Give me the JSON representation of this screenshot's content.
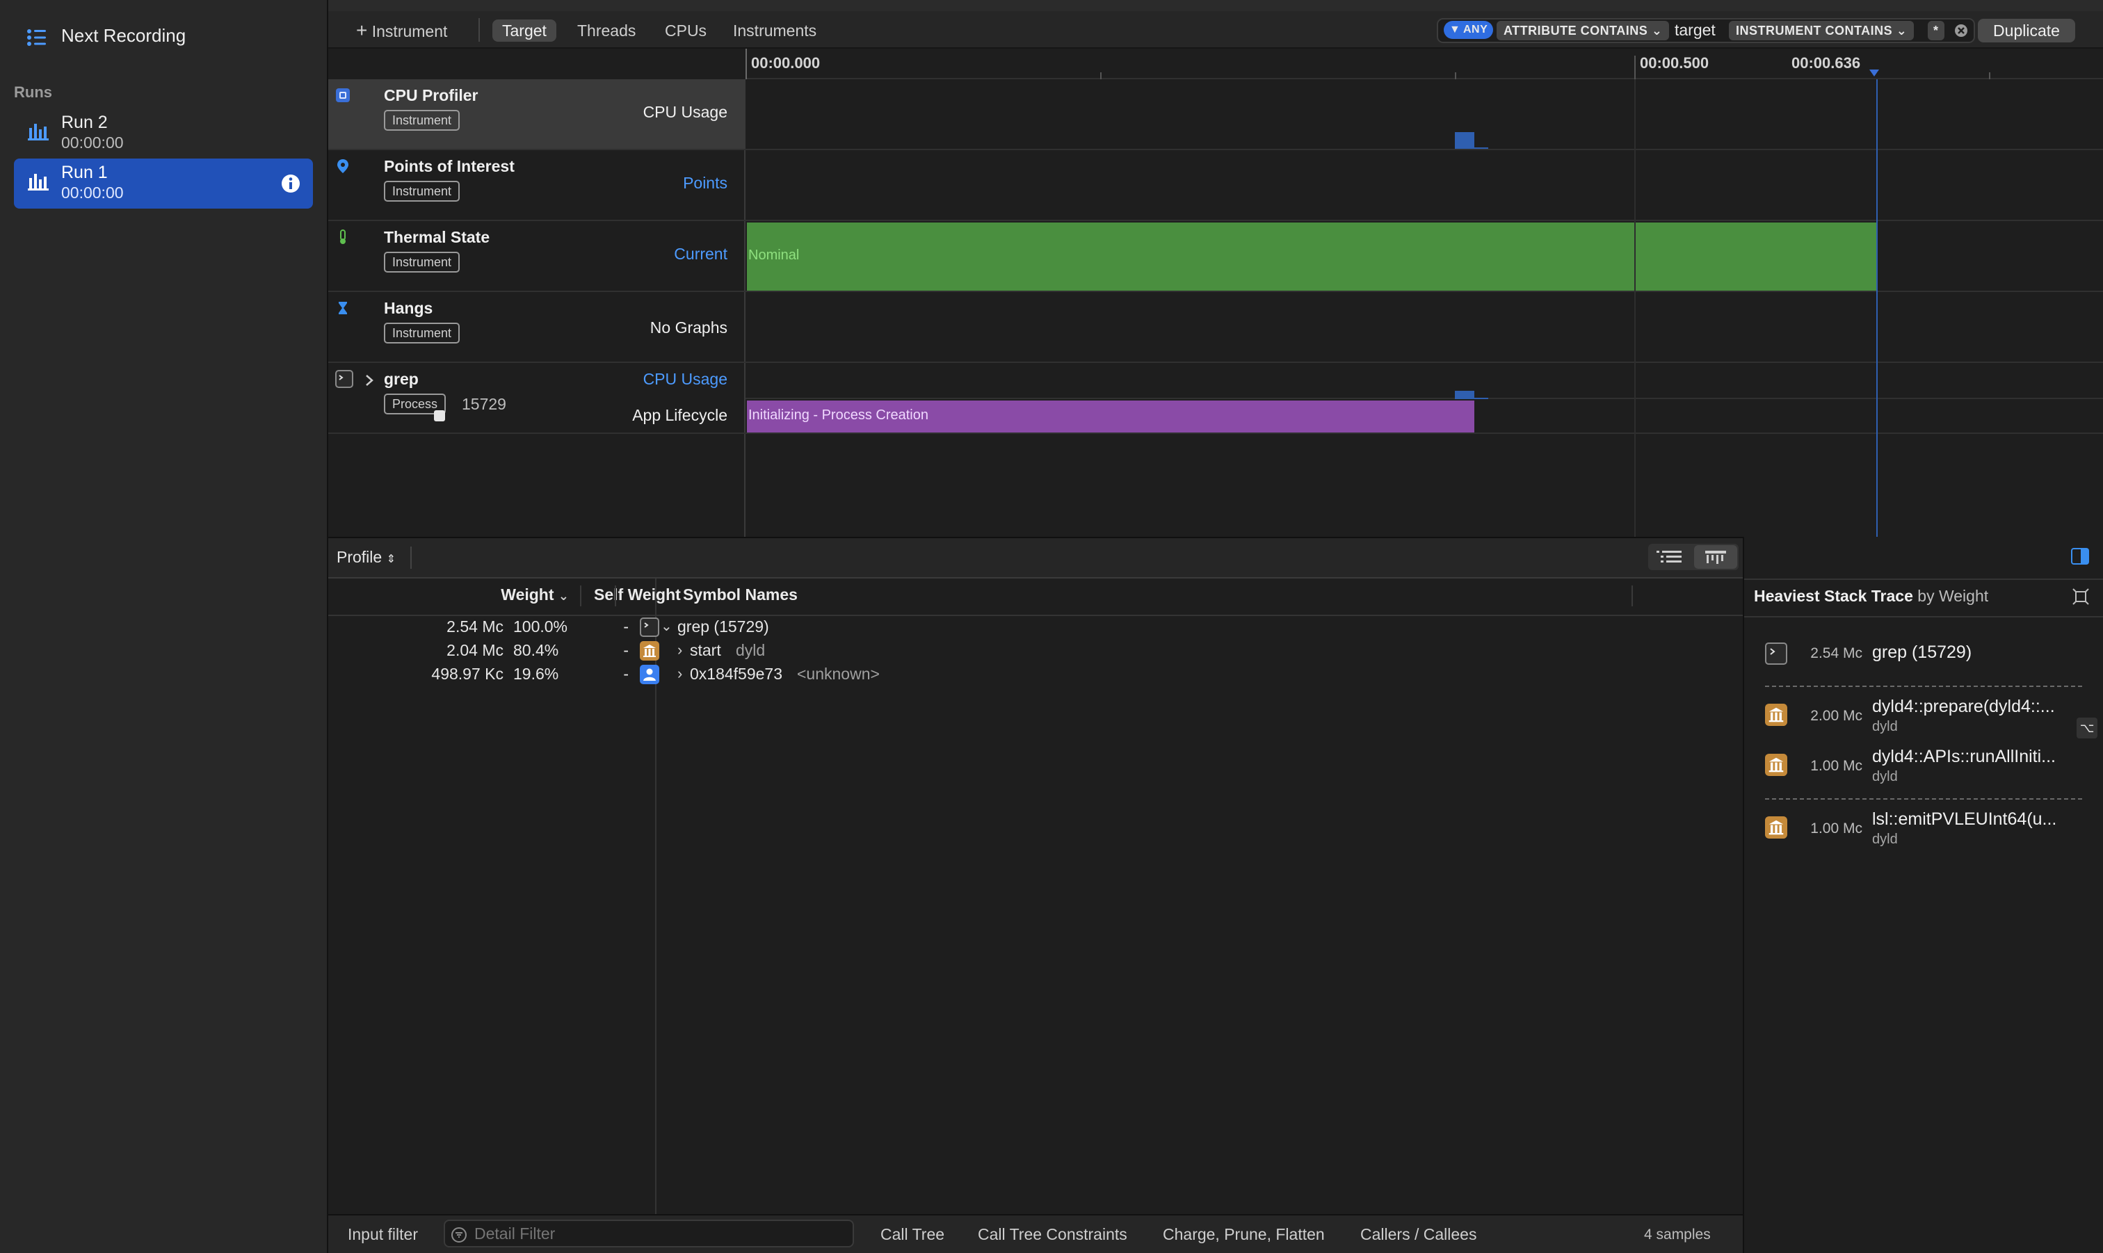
{
  "sidebar": {
    "next_recording_label": "Next Recording",
    "runs_heading": "Runs",
    "runs": [
      {
        "name": "Run 2",
        "time": "00:00:00",
        "selected": false
      },
      {
        "name": "Run 1",
        "time": "00:00:00",
        "selected": true
      }
    ]
  },
  "toolbar": {
    "add_instrument_label": "Instrument",
    "tabs": [
      "Target",
      "Threads",
      "CPUs",
      "Instruments"
    ],
    "active_tab": "Target",
    "filter": {
      "any_chip": "ANY",
      "attribute_chip": "ATTRIBUTE CONTAINS",
      "attribute_value": "target",
      "instrument_chip": "INSTRUMENT CONTAINS",
      "instrument_value": "*"
    },
    "duplicate_label": "Duplicate"
  },
  "ruler": {
    "start": "00:00.000",
    "mid": "00:00.500",
    "cursor": "00:00.636"
  },
  "tracks": [
    {
      "name": "CPU Profiler",
      "badge": "Instrument",
      "graph": "CPU Usage",
      "icon": "cpu-profiler-icon"
    },
    {
      "name": "Points of Interest",
      "badge": "Instrument",
      "graph": "Points",
      "icon": "location-pin-icon"
    },
    {
      "name": "Thermal State",
      "badge": "Instrument",
      "graph": "Current",
      "icon": "thermometer-icon",
      "bar_label": "Nominal"
    },
    {
      "name": "Hangs",
      "badge": "Instrument",
      "graph": "No Graphs",
      "icon": "hourglass-icon"
    },
    {
      "name": "grep",
      "badge": "Process",
      "pid": "15729",
      "graph": "CPU Usage",
      "graph2": "App Lifecycle",
      "icon": "terminal-icon",
      "bar_label": "Initializing - Process Creation"
    }
  ],
  "profile": {
    "mode_label": "Profile",
    "columns": {
      "weight": "Weight",
      "self_weight": "Self Weight",
      "symbol_names": "Symbol Names"
    },
    "rows": [
      {
        "weight": "2.54 Mc",
        "percent": "100.0%",
        "self": "-",
        "symbol": "grep (15729)",
        "lib": "",
        "icon": "terminal-icon",
        "expanded": true
      },
      {
        "weight": "2.04 Mc",
        "percent": "80.4%",
        "self": "-",
        "symbol": "start",
        "lib": "dyld",
        "icon": "library-icon",
        "expanded": false
      },
      {
        "weight": "498.97 Kc",
        "percent": "19.6%",
        "self": "-",
        "symbol": "0x184f59e73",
        "lib": "<unknown>",
        "icon": "user-icon",
        "expanded": false
      }
    ]
  },
  "stack_trace": {
    "title_bold": "Heaviest Stack Trace",
    "title_rest": "by Weight",
    "rows": [
      {
        "value": "2.54 Mc",
        "name": "grep (15729)",
        "lib": ""
      },
      {
        "value": "2.00 Mc",
        "name": "dyld4::prepare(dyld4::...",
        "lib": "dyld"
      },
      {
        "value": "1.00 Mc",
        "name": "dyld4::APIs::runAllIniti...",
        "lib": "dyld"
      },
      {
        "value": "1.00 Mc",
        "name": "lsl::emitPVLEUInt64(u...",
        "lib": "dyld"
      }
    ]
  },
  "footer": {
    "input_filter_label": "Input filter",
    "detail_filter_placeholder": "Detail Filter",
    "buttons": [
      "Call Tree",
      "Call Tree Constraints",
      "Charge, Prune, Flatten",
      "Callers / Callees"
    ],
    "samples": "4 samples"
  },
  "colors": {
    "accent": "#2151b8",
    "thermal_bar": "#4a8f3f",
    "lifecycle_bar": "#8a4ba7",
    "cpu_spike": "#2f5fb0",
    "link": "#4d9bff"
  }
}
